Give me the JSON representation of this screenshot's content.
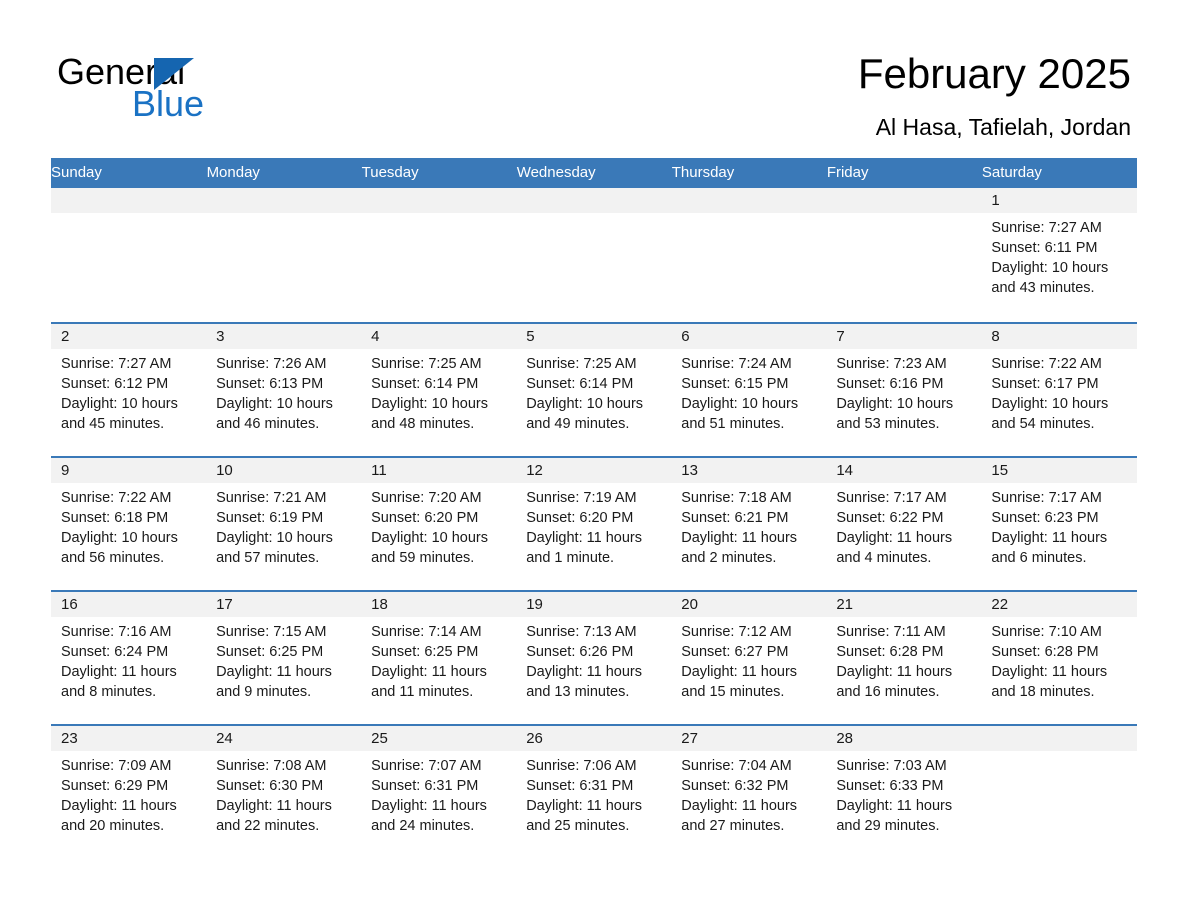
{
  "brand": {
    "name_part1": "General",
    "name_part2": "Blue",
    "triangle_color": "#1565b0",
    "blue_color": "#1a72c4"
  },
  "header": {
    "title": "February 2025",
    "subtitle": "Al Hasa, Tafielah, Jordan"
  },
  "theme": {
    "header_blue": "#3a79b8",
    "daynum_band": "#f2f2f2",
    "text": "#1a1a1a"
  },
  "weekdays": [
    "Sunday",
    "Monday",
    "Tuesday",
    "Wednesday",
    "Thursday",
    "Friday",
    "Saturday"
  ],
  "weeks": [
    [
      {
        "day": "",
        "sunrise": "",
        "sunset": "",
        "daylight": "",
        "empty": true
      },
      {
        "day": "",
        "sunrise": "",
        "sunset": "",
        "daylight": "",
        "empty": true
      },
      {
        "day": "",
        "sunrise": "",
        "sunset": "",
        "daylight": "",
        "empty": true
      },
      {
        "day": "",
        "sunrise": "",
        "sunset": "",
        "daylight": "",
        "empty": true
      },
      {
        "day": "",
        "sunrise": "",
        "sunset": "",
        "daylight": "",
        "empty": true
      },
      {
        "day": "",
        "sunrise": "",
        "sunset": "",
        "daylight": "",
        "empty": true
      },
      {
        "day": "1",
        "sunrise": "Sunrise: 7:27 AM",
        "sunset": "Sunset: 6:11 PM",
        "daylight": "Daylight: 10 hours and 43 minutes.",
        "empty": false
      }
    ],
    [
      {
        "day": "2",
        "sunrise": "Sunrise: 7:27 AM",
        "sunset": "Sunset: 6:12 PM",
        "daylight": "Daylight: 10 hours and 45 minutes.",
        "empty": false
      },
      {
        "day": "3",
        "sunrise": "Sunrise: 7:26 AM",
        "sunset": "Sunset: 6:13 PM",
        "daylight": "Daylight: 10 hours and 46 minutes.",
        "empty": false
      },
      {
        "day": "4",
        "sunrise": "Sunrise: 7:25 AM",
        "sunset": "Sunset: 6:14 PM",
        "daylight": "Daylight: 10 hours and 48 minutes.",
        "empty": false
      },
      {
        "day": "5",
        "sunrise": "Sunrise: 7:25 AM",
        "sunset": "Sunset: 6:14 PM",
        "daylight": "Daylight: 10 hours and 49 minutes.",
        "empty": false
      },
      {
        "day": "6",
        "sunrise": "Sunrise: 7:24 AM",
        "sunset": "Sunset: 6:15 PM",
        "daylight": "Daylight: 10 hours and 51 minutes.",
        "empty": false
      },
      {
        "day": "7",
        "sunrise": "Sunrise: 7:23 AM",
        "sunset": "Sunset: 6:16 PM",
        "daylight": "Daylight: 10 hours and 53 minutes.",
        "empty": false
      },
      {
        "day": "8",
        "sunrise": "Sunrise: 7:22 AM",
        "sunset": "Sunset: 6:17 PM",
        "daylight": "Daylight: 10 hours and 54 minutes.",
        "empty": false
      }
    ],
    [
      {
        "day": "9",
        "sunrise": "Sunrise: 7:22 AM",
        "sunset": "Sunset: 6:18 PM",
        "daylight": "Daylight: 10 hours and 56 minutes.",
        "empty": false
      },
      {
        "day": "10",
        "sunrise": "Sunrise: 7:21 AM",
        "sunset": "Sunset: 6:19 PM",
        "daylight": "Daylight: 10 hours and 57 minutes.",
        "empty": false
      },
      {
        "day": "11",
        "sunrise": "Sunrise: 7:20 AM",
        "sunset": "Sunset: 6:20 PM",
        "daylight": "Daylight: 10 hours and 59 minutes.",
        "empty": false
      },
      {
        "day": "12",
        "sunrise": "Sunrise: 7:19 AM",
        "sunset": "Sunset: 6:20 PM",
        "daylight": "Daylight: 11 hours and 1 minute.",
        "empty": false
      },
      {
        "day": "13",
        "sunrise": "Sunrise: 7:18 AM",
        "sunset": "Sunset: 6:21 PM",
        "daylight": "Daylight: 11 hours and 2 minutes.",
        "empty": false
      },
      {
        "day": "14",
        "sunrise": "Sunrise: 7:17 AM",
        "sunset": "Sunset: 6:22 PM",
        "daylight": "Daylight: 11 hours and 4 minutes.",
        "empty": false
      },
      {
        "day": "15",
        "sunrise": "Sunrise: 7:17 AM",
        "sunset": "Sunset: 6:23 PM",
        "daylight": "Daylight: 11 hours and 6 minutes.",
        "empty": false
      }
    ],
    [
      {
        "day": "16",
        "sunrise": "Sunrise: 7:16 AM",
        "sunset": "Sunset: 6:24 PM",
        "daylight": "Daylight: 11 hours and 8 minutes.",
        "empty": false
      },
      {
        "day": "17",
        "sunrise": "Sunrise: 7:15 AM",
        "sunset": "Sunset: 6:25 PM",
        "daylight": "Daylight: 11 hours and 9 minutes.",
        "empty": false
      },
      {
        "day": "18",
        "sunrise": "Sunrise: 7:14 AM",
        "sunset": "Sunset: 6:25 PM",
        "daylight": "Daylight: 11 hours and 11 minutes.",
        "empty": false
      },
      {
        "day": "19",
        "sunrise": "Sunrise: 7:13 AM",
        "sunset": "Sunset: 6:26 PM",
        "daylight": "Daylight: 11 hours and 13 minutes.",
        "empty": false
      },
      {
        "day": "20",
        "sunrise": "Sunrise: 7:12 AM",
        "sunset": "Sunset: 6:27 PM",
        "daylight": "Daylight: 11 hours and 15 minutes.",
        "empty": false
      },
      {
        "day": "21",
        "sunrise": "Sunrise: 7:11 AM",
        "sunset": "Sunset: 6:28 PM",
        "daylight": "Daylight: 11 hours and 16 minutes.",
        "empty": false
      },
      {
        "day": "22",
        "sunrise": "Sunrise: 7:10 AM",
        "sunset": "Sunset: 6:28 PM",
        "daylight": "Daylight: 11 hours and 18 minutes.",
        "empty": false
      }
    ],
    [
      {
        "day": "23",
        "sunrise": "Sunrise: 7:09 AM",
        "sunset": "Sunset: 6:29 PM",
        "daylight": "Daylight: 11 hours and 20 minutes.",
        "empty": false
      },
      {
        "day": "24",
        "sunrise": "Sunrise: 7:08 AM",
        "sunset": "Sunset: 6:30 PM",
        "daylight": "Daylight: 11 hours and 22 minutes.",
        "empty": false
      },
      {
        "day": "25",
        "sunrise": "Sunrise: 7:07 AM",
        "sunset": "Sunset: 6:31 PM",
        "daylight": "Daylight: 11 hours and 24 minutes.",
        "empty": false
      },
      {
        "day": "26",
        "sunrise": "Sunrise: 7:06 AM",
        "sunset": "Sunset: 6:31 PM",
        "daylight": "Daylight: 11 hours and 25 minutes.",
        "empty": false
      },
      {
        "day": "27",
        "sunrise": "Sunrise: 7:04 AM",
        "sunset": "Sunset: 6:32 PM",
        "daylight": "Daylight: 11 hours and 27 minutes.",
        "empty": false
      },
      {
        "day": "28",
        "sunrise": "Sunrise: 7:03 AM",
        "sunset": "Sunset: 6:33 PM",
        "daylight": "Daylight: 11 hours and 29 minutes.",
        "empty": false
      },
      {
        "day": "",
        "sunrise": "",
        "sunset": "",
        "daylight": "",
        "empty": true
      }
    ]
  ]
}
